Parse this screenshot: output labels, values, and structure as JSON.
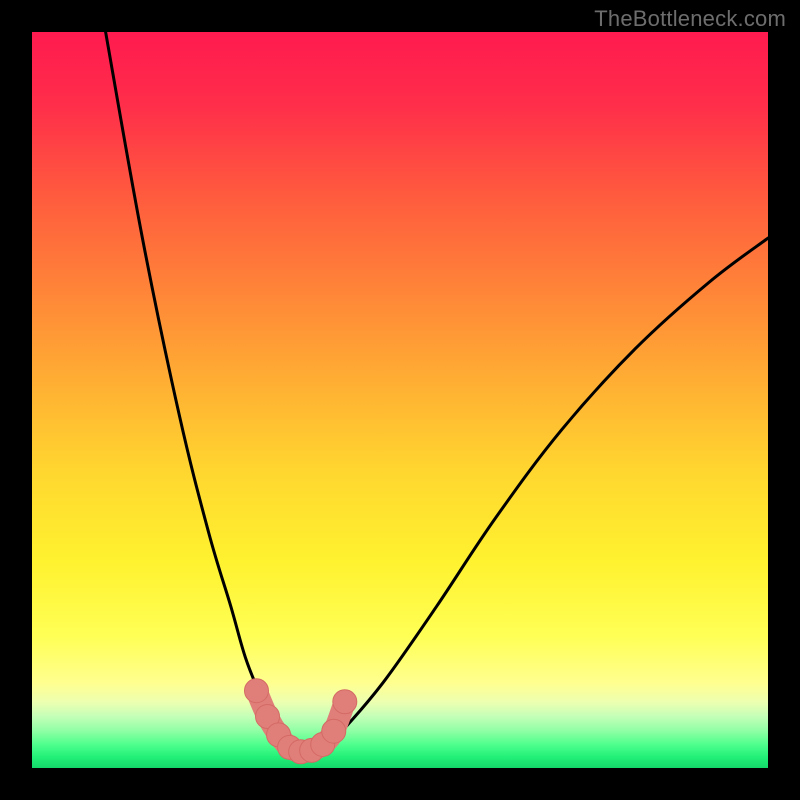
{
  "watermark": "TheBottleneck.com",
  "colors": {
    "black": "#000000",
    "curve": "#000000",
    "marker_fill": "#e07f7a",
    "marker_stroke": "#d46a64"
  },
  "chart_data": {
    "type": "line",
    "title": "",
    "xlabel": "",
    "ylabel": "",
    "xlim": [
      0,
      100
    ],
    "ylim": [
      0,
      100
    ],
    "grid": false,
    "series": [
      {
        "name": "left-curve",
        "x": [
          10,
          15,
          20,
          24,
          27,
          29,
          31,
          33,
          34.5,
          35.5,
          36
        ],
        "y": [
          100,
          72,
          48,
          32,
          22,
          15,
          10,
          6,
          3.5,
          2.2,
          2
        ]
      },
      {
        "name": "right-curve",
        "x": [
          38,
          40,
          43,
          48,
          55,
          63,
          72,
          82,
          92,
          100
        ],
        "y": [
          2,
          3,
          6,
          12,
          22,
          34,
          46,
          57,
          66,
          72
        ]
      },
      {
        "name": "valley-base",
        "x": [
          35,
          36,
          37,
          38,
          39
        ],
        "y": [
          2,
          1.8,
          1.8,
          1.9,
          2
        ]
      }
    ],
    "markers": [
      {
        "x": 30.5,
        "y": 10.5
      },
      {
        "x": 32.0,
        "y": 7.0
      },
      {
        "x": 33.5,
        "y": 4.5
      },
      {
        "x": 35.0,
        "y": 2.8
      },
      {
        "x": 36.5,
        "y": 2.2
      },
      {
        "x": 38.0,
        "y": 2.4
      },
      {
        "x": 39.5,
        "y": 3.2
      },
      {
        "x": 41.0,
        "y": 5.0
      },
      {
        "x": 42.5,
        "y": 9.0
      }
    ],
    "gradient_stops": [
      {
        "offset": 0.0,
        "color": "#ff1a4f"
      },
      {
        "offset": 0.1,
        "color": "#ff2e4a"
      },
      {
        "offset": 0.22,
        "color": "#ff5a3e"
      },
      {
        "offset": 0.35,
        "color": "#ff8438"
      },
      {
        "offset": 0.48,
        "color": "#ffb033"
      },
      {
        "offset": 0.6,
        "color": "#ffd72f"
      },
      {
        "offset": 0.72,
        "color": "#fff22f"
      },
      {
        "offset": 0.82,
        "color": "#ffff55"
      },
      {
        "offset": 0.885,
        "color": "#ffff90"
      },
      {
        "offset": 0.91,
        "color": "#edffb0"
      },
      {
        "offset": 0.93,
        "color": "#c4ffb8"
      },
      {
        "offset": 0.95,
        "color": "#8effa4"
      },
      {
        "offset": 0.968,
        "color": "#4fff8e"
      },
      {
        "offset": 0.985,
        "color": "#22f078"
      },
      {
        "offset": 1.0,
        "color": "#14d86a"
      }
    ]
  }
}
